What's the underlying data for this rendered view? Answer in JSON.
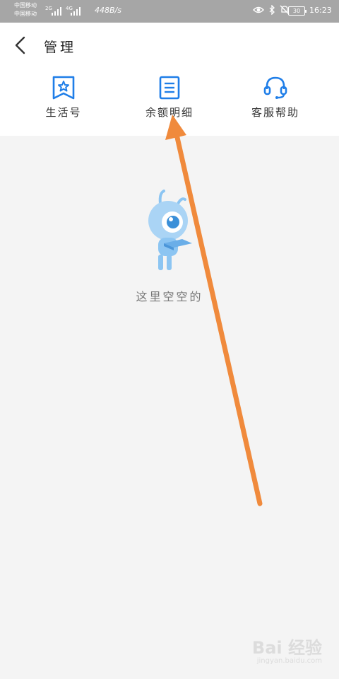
{
  "status_bar": {
    "carrier_1": "中国移动",
    "carrier_2": "中国移动",
    "network_1": "2G",
    "network_2": "4G",
    "speed": "448B/s",
    "battery": "30",
    "time": "16:23",
    "icons": [
      "eye-comfort-icon",
      "bluetooth-icon",
      "mute-icon"
    ]
  },
  "header": {
    "back_icon": "chevron-left-icon",
    "title": "管理"
  },
  "actions": [
    {
      "label": "生活号",
      "icon": "star-bookmark-icon"
    },
    {
      "label": "余额明细",
      "icon": "document-list-icon"
    },
    {
      "label": "客服帮助",
      "icon": "headset-icon"
    }
  ],
  "empty_state": {
    "text": "这里空空的",
    "illustration": "ant-mascot-reading-icon"
  },
  "overlay": {
    "arrow_color": "#f08a3c"
  },
  "watermark": {
    "brand": "Bai 经验",
    "url": "jingyan.baidu.com"
  },
  "colors": {
    "accent": "#1f7ee8",
    "mascot": "#8cc5f2",
    "background": "#f4f4f4"
  }
}
